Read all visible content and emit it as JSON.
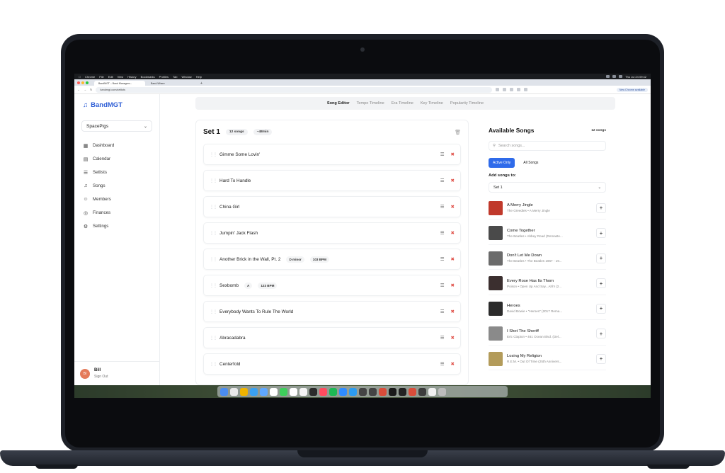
{
  "mac_menubar": {
    "items": [
      "Chrome",
      "File",
      "Edit",
      "View",
      "History",
      "Bookmarks",
      "Profiles",
      "Tab",
      "Window",
      "Help"
    ],
    "clock": "Thu Jul 24 09:42"
  },
  "browser": {
    "tabs": [
      {
        "label": "BandMGT – Band Managem...",
        "active": true
      },
      {
        "label": "Band-Where",
        "active": false
      }
    ],
    "url": "bandmgt.com/setlists",
    "new_chrome": "New Chrome available"
  },
  "app": {
    "logo": "BandMGT",
    "band": "SpacePigs",
    "nav": [
      {
        "label": "Dashboard",
        "icon": "grid-icon"
      },
      {
        "label": "Calendar",
        "icon": "calendar-icon"
      },
      {
        "label": "Setlists",
        "icon": "list-icon"
      },
      {
        "label": "Songs",
        "icon": "music-note-icon"
      },
      {
        "label": "Members",
        "icon": "users-icon"
      },
      {
        "label": "Finances",
        "icon": "coins-icon"
      },
      {
        "label": "Settings",
        "icon": "gear-icon"
      }
    ],
    "user": {
      "initials": "BI",
      "name": "Bill",
      "sign_out": "Sign Out"
    }
  },
  "view_tabs": [
    {
      "label": "Song Editor",
      "active": true
    },
    {
      "label": "Tempo Timeline",
      "active": false
    },
    {
      "label": "Era Timeline",
      "active": false
    },
    {
      "label": "Key Timeline",
      "active": false
    },
    {
      "label": "Popularity Timeline",
      "active": false
    }
  ],
  "set": {
    "title": "Set 1",
    "song_count": "12 songs",
    "duration": "~48min",
    "songs": [
      {
        "title": "Gimme Some Lovin'",
        "key": "",
        "bpm": ""
      },
      {
        "title": "Hard To Handle",
        "key": "",
        "bpm": ""
      },
      {
        "title": "China Girl",
        "key": "",
        "bpm": ""
      },
      {
        "title": "Jumpin' Jack Flash",
        "key": "",
        "bpm": ""
      },
      {
        "title": "Another Brick in the Wall, Pt. 2",
        "key": "D minor",
        "bpm": "103 BPM"
      },
      {
        "title": "Sexbomb",
        "key": "A",
        "bpm": "123 BPM"
      },
      {
        "title": "Everybody Wants To Rule The World",
        "key": "",
        "bpm": ""
      },
      {
        "title": "Abracadabra",
        "key": "",
        "bpm": ""
      },
      {
        "title": "Centerfold",
        "key": "",
        "bpm": ""
      }
    ]
  },
  "available": {
    "title": "Available Songs",
    "count": "12 songs",
    "search_placeholder": "Search songs...",
    "filter_active": "Active Only",
    "filter_all": "All Songs",
    "add_to_label": "Add songs to:",
    "target_set": "Set 1",
    "songs": [
      {
        "title": "A Merry Jingle",
        "sub": "The Greedies • A Merry Jingle",
        "color": "#c0392b"
      },
      {
        "title": "Come Together",
        "sub": "The Beatles • Abbey Road (Remaste...",
        "color": "#4a4a4a"
      },
      {
        "title": "Don't Let Me Down",
        "sub": "The Beatles • The Beatles 1967 - 19...",
        "color": "#6b6b6b"
      },
      {
        "title": "Every Rose Has Its Thorn",
        "sub": "Poison • Open Up And Say...Ahh! (2...",
        "color": "#3b2f2f"
      },
      {
        "title": "Heroes",
        "sub": "David Bowie • \"Heroes\" (2017 Rema...",
        "color": "#2b2b2b"
      },
      {
        "title": "I Shot The Sheriff",
        "sub": "Eric Clapton • 461 Ocean Blvd. (Del...",
        "color": "#8a8a8a"
      },
      {
        "title": "Losing My Religion",
        "sub": "R.E.M. • Out Of Time (25th Annivers...",
        "color": "#b39b5a"
      }
    ]
  },
  "dock": {
    "icons": [
      "#4a8cf0",
      "#e9e9e9",
      "#f0b400",
      "#3aa0f0",
      "#5fa8ff",
      "#ffffff",
      "#3ecf5b",
      "#ffffff",
      "#f5f5f5",
      "#2b2b2b",
      "#ff4c5f",
      "#1db954",
      "#2f8cff",
      "#2c9cf0",
      "#444444",
      "#444444",
      "#d94d3a",
      "#1a1a1a",
      "#222222",
      "#d94d3a",
      "#3c3c3c",
      "#f0f0f0",
      "#bcbcbc"
    ]
  }
}
